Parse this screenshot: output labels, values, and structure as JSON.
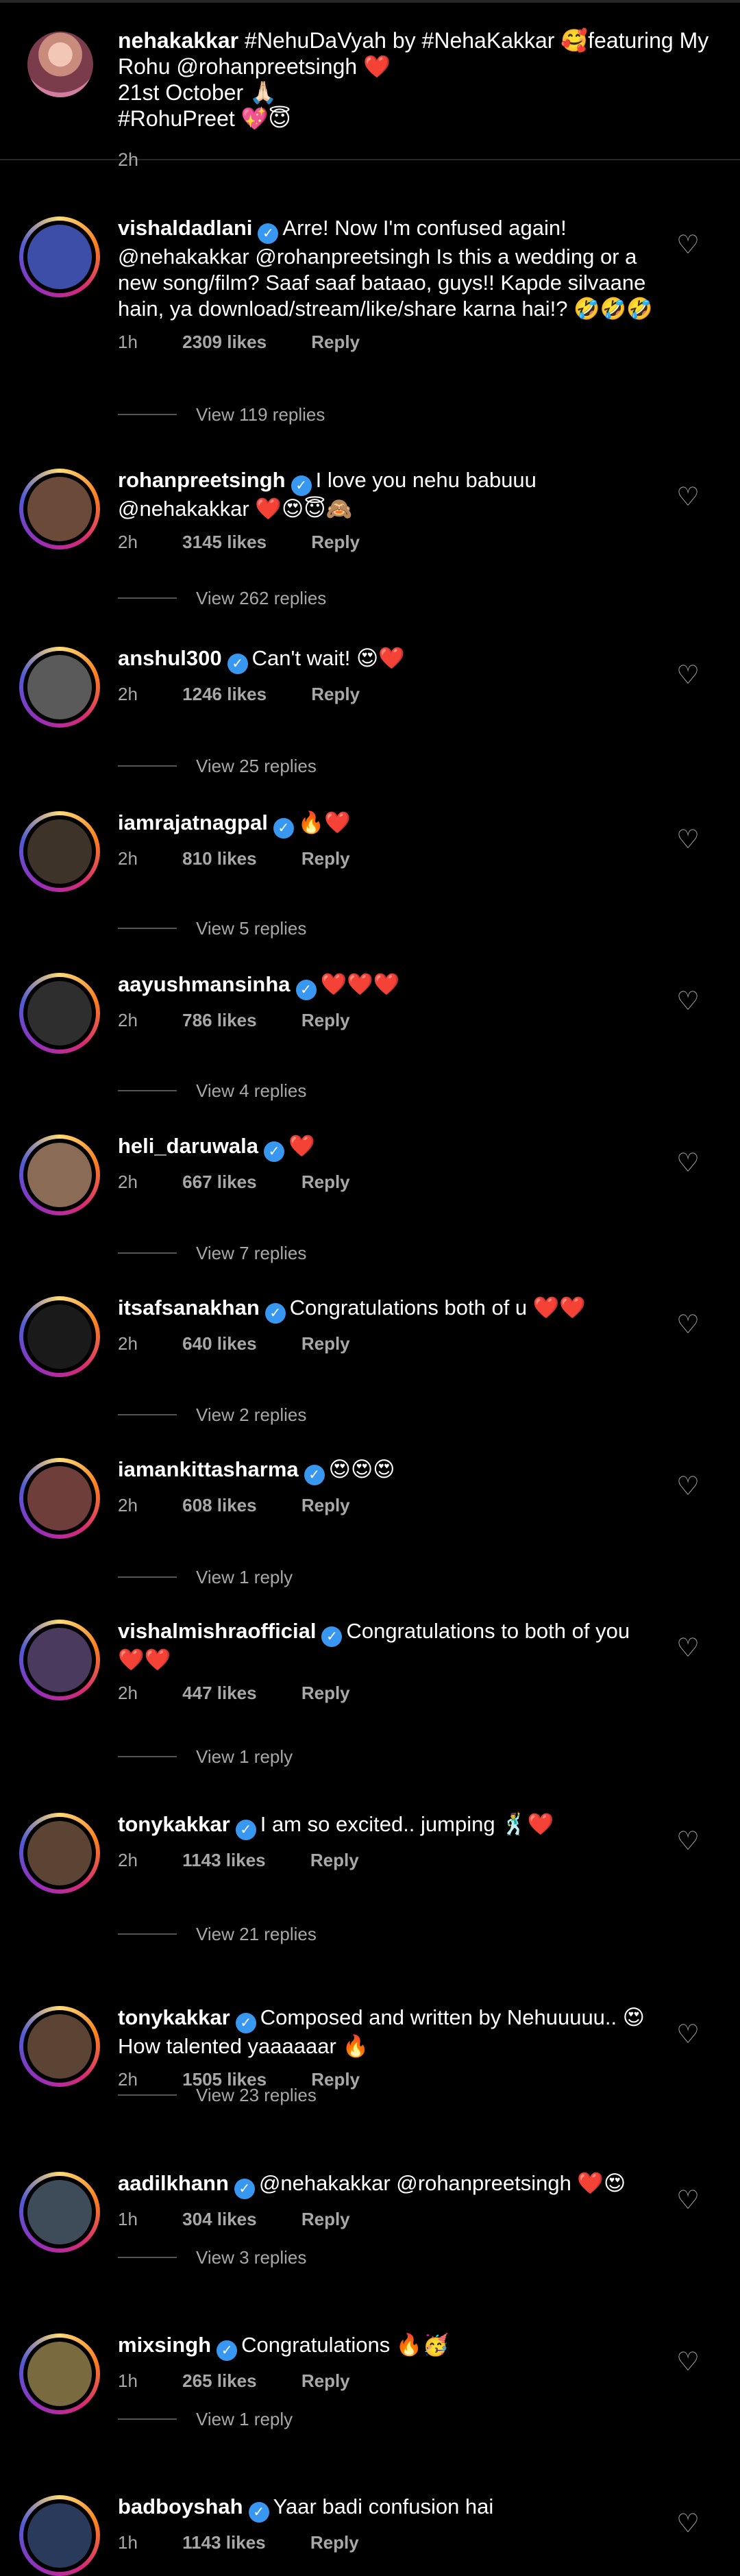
{
  "caption": {
    "username": "nehakakkar",
    "text_line1": " #NehuDaVyah by #NehaKakkar 🥰featuring My",
    "text_line2": "Rohu @rohanpreetsingh ❤️",
    "text_line3": "21st October 🙏🏻",
    "text_line4": "#RohuPreet 💖😇",
    "time": "2h"
  },
  "comments": [
    {
      "username": "vishaldadlani",
      "verified": true,
      "text": "Arre! Now I'm confused again! @nehakakkar @rohanpreetsingh Is this a wedding or a new song/film? Saaf saaf bataao, guys!! Kapde silvaane hain, ya download/stream/like/share karna hai!? 🤣🤣🤣",
      "time": "1h",
      "likes": "2309 likes",
      "reply": "Reply",
      "view_replies": "View 119 replies",
      "avatar": "#3c4ea8"
    },
    {
      "username": "rohanpreetsingh",
      "verified": true,
      "text": "I love you nehu babuuu @nehakakkar ❤️😍😇🙈",
      "time": "2h",
      "likes": "3145 likes",
      "reply": "Reply",
      "view_replies": "View 262 replies",
      "avatar": "#6b4a3a"
    },
    {
      "username": "anshul300",
      "verified": true,
      "text": "Can't wait! 😍❤️",
      "time": "2h",
      "likes": "1246 likes",
      "reply": "Reply",
      "view_replies": "View 25 replies",
      "avatar": "#5a5a5a"
    },
    {
      "username": "iamrajatnagpal",
      "verified": true,
      "text": "🔥❤️",
      "time": "2h",
      "likes": "810 likes",
      "reply": "Reply",
      "view_replies": "View 5 replies",
      "avatar": "#3d3328"
    },
    {
      "username": "aayushmansinha",
      "verified": true,
      "text": "❤️❤️❤️",
      "time": "2h",
      "likes": "786 likes",
      "reply": "Reply",
      "view_replies": "View 4 replies",
      "avatar": "#2e2e2e"
    },
    {
      "username": "heli_daruwala",
      "verified": true,
      "text": "❤️",
      "time": "2h",
      "likes": "667 likes",
      "reply": "Reply",
      "view_replies": "View 7 replies",
      "avatar": "#8a6b55"
    },
    {
      "username": "itsafsanakhan",
      "verified": true,
      "text": "Congratulations both of u ❤️❤️",
      "time": "2h",
      "likes": "640 likes",
      "reply": "Reply",
      "view_replies": "View 2 replies",
      "avatar": "#1a1a1a"
    },
    {
      "username": "iamankittasharma",
      "verified": true,
      "text": "😍😍😍",
      "time": "2h",
      "likes": "608 likes",
      "reply": "Reply",
      "view_replies": "View 1 reply",
      "avatar": "#6e3e3a"
    },
    {
      "username": "vishalmishraofficial",
      "verified": true,
      "text": "Congratulations to both of you ❤️❤️",
      "time": "2h",
      "likes": "447 likes",
      "reply": "Reply",
      "view_replies": "View 1 reply",
      "avatar": "#4a3a5e"
    },
    {
      "username": "tonykakkar",
      "verified": true,
      "text": "I am so excited.. jumping 🕺❤️",
      "time": "2h",
      "likes": "1143 likes",
      "reply": "Reply",
      "view_replies": "View 21 replies",
      "avatar": "#5b4433"
    },
    {
      "username": "tonykakkar",
      "verified": true,
      "text": "Composed and written by Nehuuuuu.. 😍 How talented yaaaaaar 🔥",
      "time": "2h",
      "likes": "1505 likes",
      "reply": "Reply",
      "view_replies": "View 23 replies",
      "avatar": "#5b4433"
    },
    {
      "username": "aadilkhann",
      "verified": true,
      "text": "@nehakakkar @rohanpreetsingh ❤️😍",
      "time": "1h",
      "likes": "304 likes",
      "reply": "Reply",
      "view_replies": "View 3 replies",
      "avatar": "#3e4c5a"
    },
    {
      "username": "mixsingh",
      "verified": true,
      "text": "Congratulations 🔥🥳",
      "time": "1h",
      "likes": "265 likes",
      "reply": "Reply",
      "view_replies": "View 1 reply",
      "avatar": "#7a6a40"
    },
    {
      "username": "badboyshah",
      "verified": true,
      "text": "Yaar badi confusion hai",
      "time": "1h",
      "likes": "1143 likes",
      "reply": "Reply",
      "view_replies": "",
      "avatar": "#2a3a5a"
    }
  ]
}
